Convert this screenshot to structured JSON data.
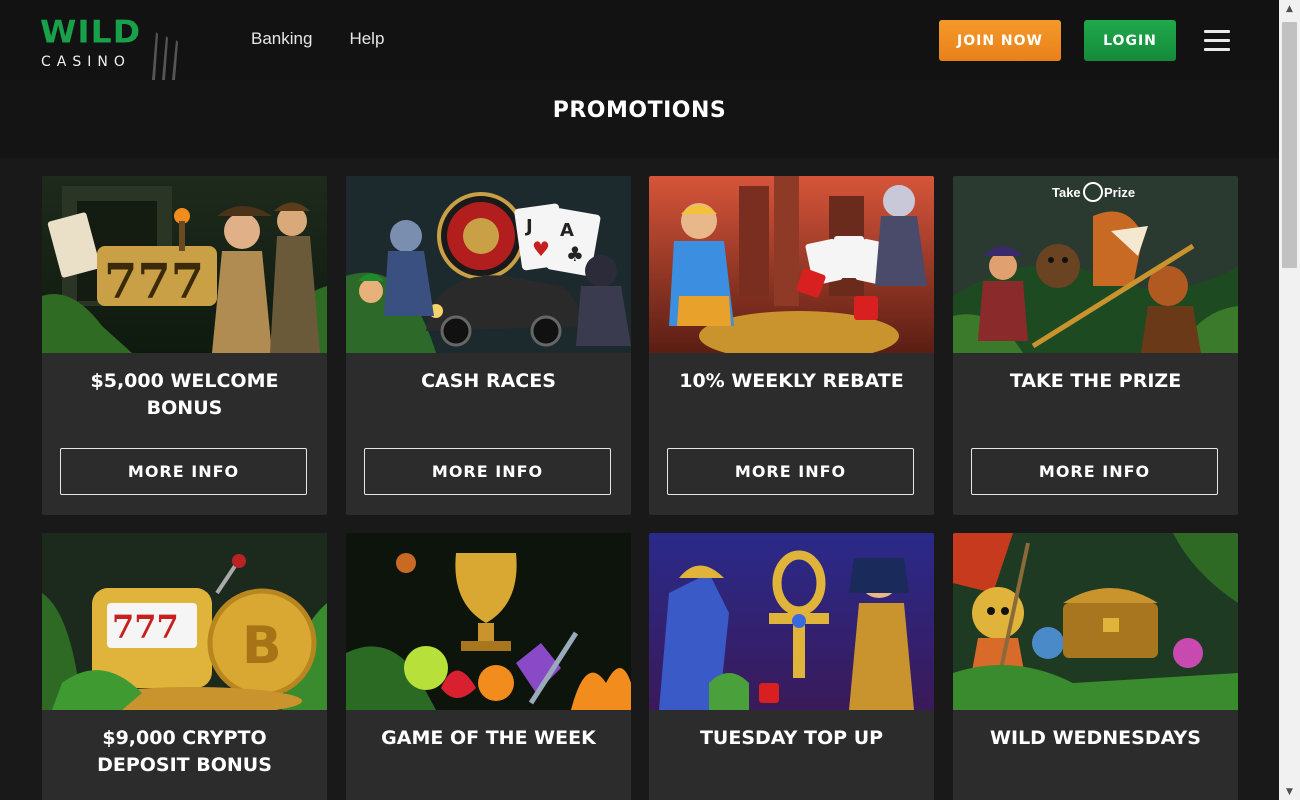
{
  "header": {
    "logo": {
      "word1": "WILD",
      "word2": "CASINO"
    },
    "nav": [
      {
        "label": "Banking"
      },
      {
        "label": "Help"
      }
    ],
    "join_label": "JOIN NOW",
    "login_label": "LOGIN",
    "menu_icon": "hamburger-icon"
  },
  "page": {
    "title": "PROMOTIONS"
  },
  "promotions": [
    {
      "title": "$5,000 WELCOME BONUS",
      "button": "MORE INFO",
      "art": "jungle-explorer-777-slot"
    },
    {
      "title": "CASH RACES",
      "button": "MORE INFO",
      "art": "roulette-cards-race"
    },
    {
      "title": "10% WEEKLY REBATE",
      "button": "MORE INFO",
      "art": "superhero-coins-dice"
    },
    {
      "title": "TAKE THE PRIZE",
      "button": "MORE INFO",
      "art": "take-the-prize-characters",
      "art_text": "Take Prize"
    },
    {
      "title": "$9,000 CRYPTO DEPOSIT BONUS",
      "art": "bitcoin-slot-machine"
    },
    {
      "title": "GAME OF THE WEEK",
      "art": "trophy-fruit-symbols"
    },
    {
      "title": "TUESDAY TOP UP",
      "art": "egyptian-ankh-cleopatra"
    },
    {
      "title": "WILD WEDNESDAYS",
      "art": "aztec-treasure-chest"
    }
  ],
  "colors": {
    "brand_green": "#18a14a",
    "join_orange": "#f08a20",
    "login_green": "#1a9c44",
    "card_bg": "#2c2c2c",
    "page_bg": "#191919"
  }
}
